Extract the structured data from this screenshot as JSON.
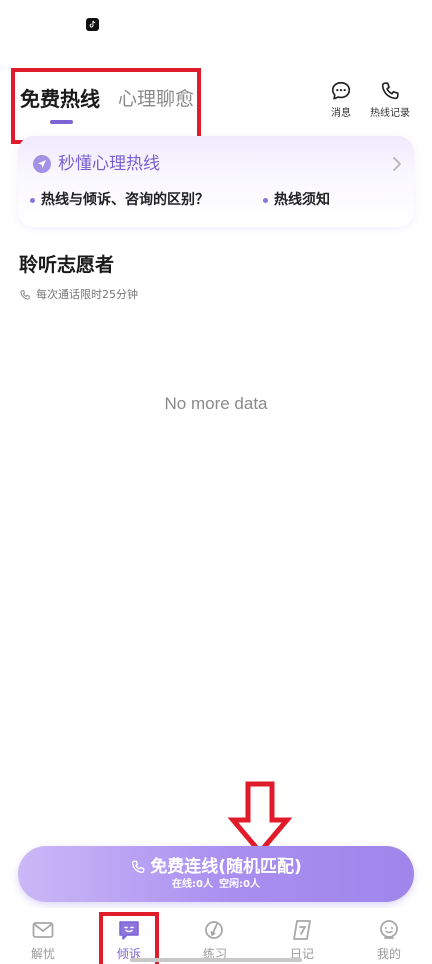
{
  "tabs": [
    {
      "label": "免费热线",
      "active": true
    },
    {
      "label": "心理聊愈",
      "active": false
    }
  ],
  "header_actions": {
    "messages": "消息",
    "records": "热线记录"
  },
  "info_card": {
    "title": "秒懂心理热线",
    "links": [
      "热线与倾诉、咨询的区别？",
      "热线须知"
    ]
  },
  "section": {
    "title": "聆听志愿者",
    "subtitle": "每次通话限时25分钟"
  },
  "empty_text": "No more data",
  "connect_button": {
    "label": "免费连线(随机匹配)",
    "online": "在线:0人",
    "idle": "空闲:0人"
  },
  "bottom_nav": [
    {
      "label": "解忧",
      "icon": "mail-icon",
      "active": false
    },
    {
      "label": "倾诉",
      "icon": "chat-face-icon",
      "active": true
    },
    {
      "label": "练习",
      "icon": "practice-icon",
      "active": false
    },
    {
      "label": "日记",
      "icon": "diary-icon",
      "active": false
    },
    {
      "label": "我的",
      "icon": "profile-icon",
      "active": false
    }
  ],
  "colors": {
    "accent": "#7c63d6",
    "annotation_red": "#e01b2a",
    "button_gradient_start": "#cbb8f7",
    "button_gradient_end": "#9f86ea"
  }
}
